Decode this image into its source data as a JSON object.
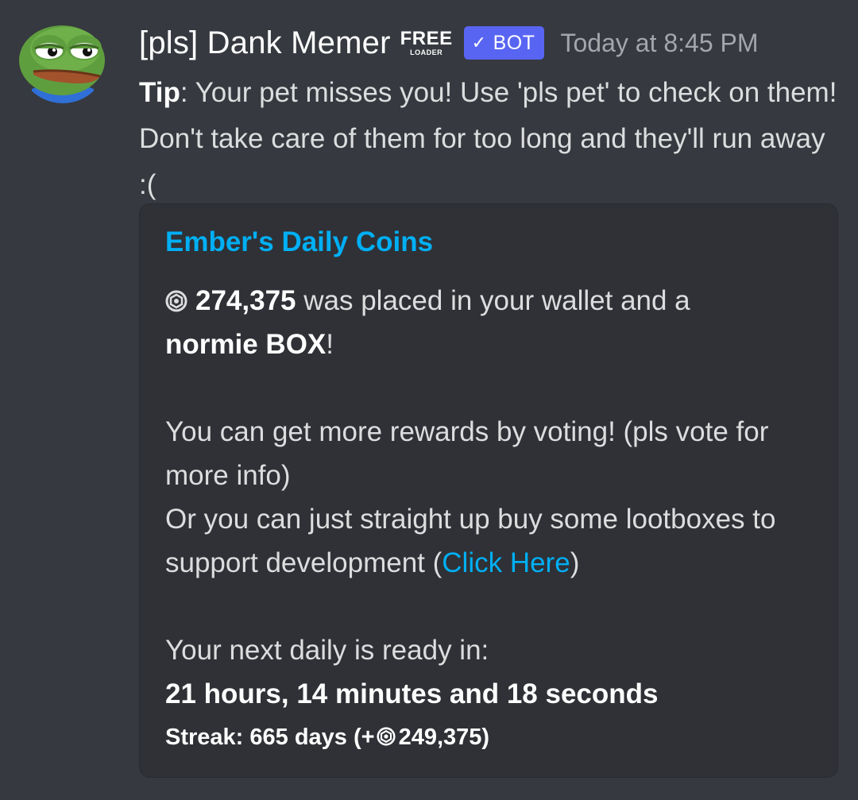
{
  "message": {
    "author": {
      "name": "[pls] Dank Memer",
      "badge_top": "FREE",
      "badge_bottom": "LOADER",
      "bot_tag": "BOT",
      "bot_check": "✓"
    },
    "timestamp": "Today at 8:45 PM",
    "tip_label": "Tip",
    "tip_text": ": Your pet misses you! Use 'pls pet' to check on them! Don't take care of them for too long and they'll run away :("
  },
  "embed": {
    "title": "Ember's Daily Coins",
    "coin_amount": "274,375",
    "wallet_text": " was placed in your wallet and a",
    "box_name": "normie BOX",
    "box_suffix": "!",
    "vote_text": "You can get more rewards by voting! (pls vote for more info)",
    "lootbox_text": "Or you can just straight up buy some lootboxes to support development (",
    "link_label": "Click Here",
    "link_close": ")",
    "next_daily_label": "Your next daily is ready in:",
    "next_daily_time": "21 hours, 14 minutes and 18 seconds",
    "streak_prefix": "Streak: 665 days (+",
    "streak_bonus": "249,375",
    "streak_suffix": ")"
  },
  "colors": {
    "background": "#36393f",
    "embed_background": "#2f3136",
    "link": "#00aff4",
    "bot_tag": "#5865f2",
    "timestamp": "#a3a6aa"
  },
  "icons": {
    "avatar": "pepe-frog-avatar",
    "coin": "coin-icon",
    "verified": "check-icon"
  }
}
